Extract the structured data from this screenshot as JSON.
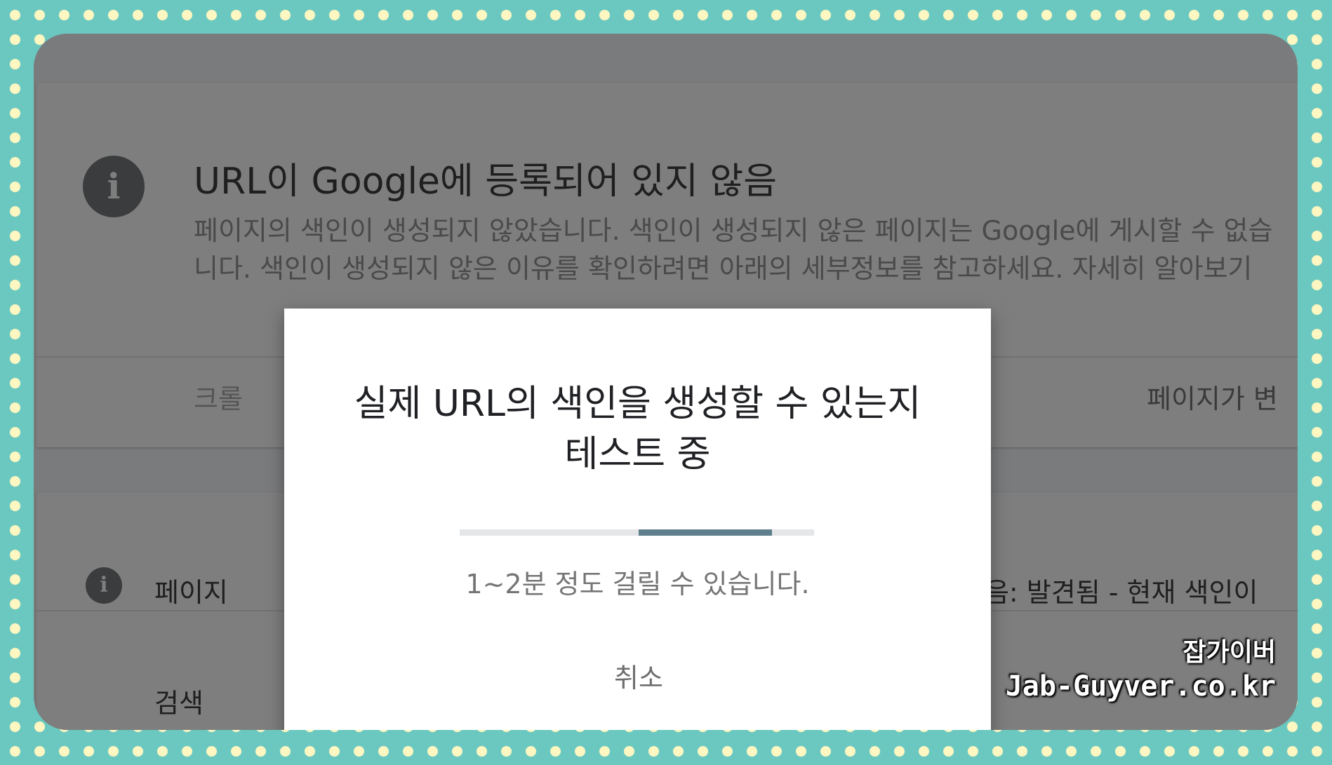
{
  "status_card": {
    "title": "URL이 Google에 등록되어 있지 않음",
    "description": "페이지의 색인이 생성되지 않았습니다. 색인이 생성되지 않은 페이지는 Google에 게시할 수 없습니다. 색인이 생성되지 않은 이유를 확인하려면 아래의 세부정보를 참고하세요. 자세히 알아보기",
    "crawl_label": "크롤",
    "page_changed_label": "페이지가 변"
  },
  "page_status_card": {
    "label": "페이지",
    "detail": "않음: 발견됨 - 현재 색인이",
    "search_label": "검색"
  },
  "dialog": {
    "title": "실제 URL의 색인을 생성할 수 있는지 테스트 중",
    "subtitle": "1~2분 정도 걸릴 수 있습니다.",
    "cancel_label": "취소"
  },
  "watermark": {
    "korean": "잡가이버",
    "domain": "Jab-Guyver.co.kr"
  },
  "colors": {
    "background": "#6bc8c0",
    "polka_dot": "#fff7c2",
    "overlay": "#7a7b7d",
    "progress_fill": "#5f7f8c",
    "progress_track": "#e4e6e8"
  }
}
